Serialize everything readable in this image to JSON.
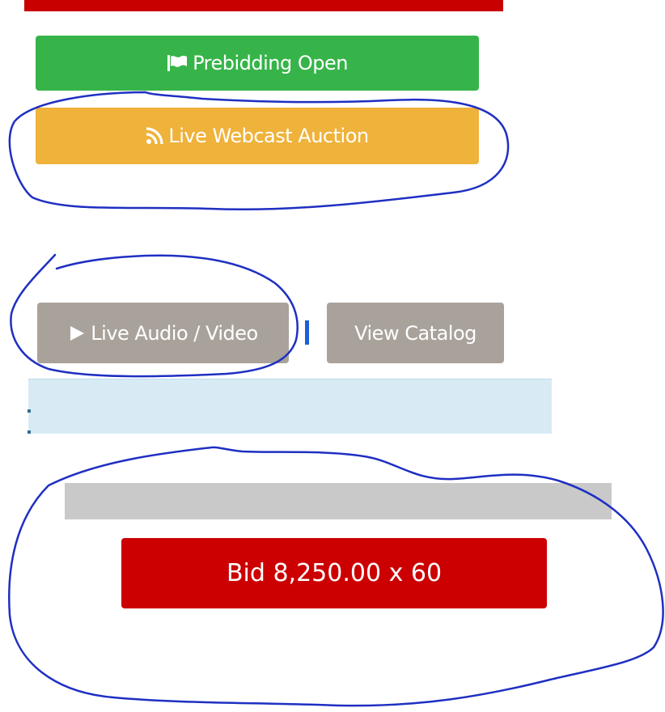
{
  "buttons": {
    "prebidding": {
      "label": "Prebidding Open",
      "icon": "flag-icon",
      "color": "#36b449"
    },
    "webcast": {
      "label": "Live Webcast Auction",
      "icon": "rss-icon",
      "color": "#efb23a"
    },
    "audio_video": {
      "label": "Live Audio / Video",
      "icon": "play-icon",
      "color": "#a9a29b"
    },
    "catalog": {
      "label": "View Catalog",
      "color": "#a9a29b"
    },
    "bid": {
      "label": "Bid 8,250.00 x 60",
      "color": "#cc0000"
    }
  },
  "colors": {
    "top_bar": "#c90000",
    "info_band": "#d8ebf5",
    "gray_strip": "#c9c9c9",
    "annotation_ink": "#1f2fc2"
  }
}
